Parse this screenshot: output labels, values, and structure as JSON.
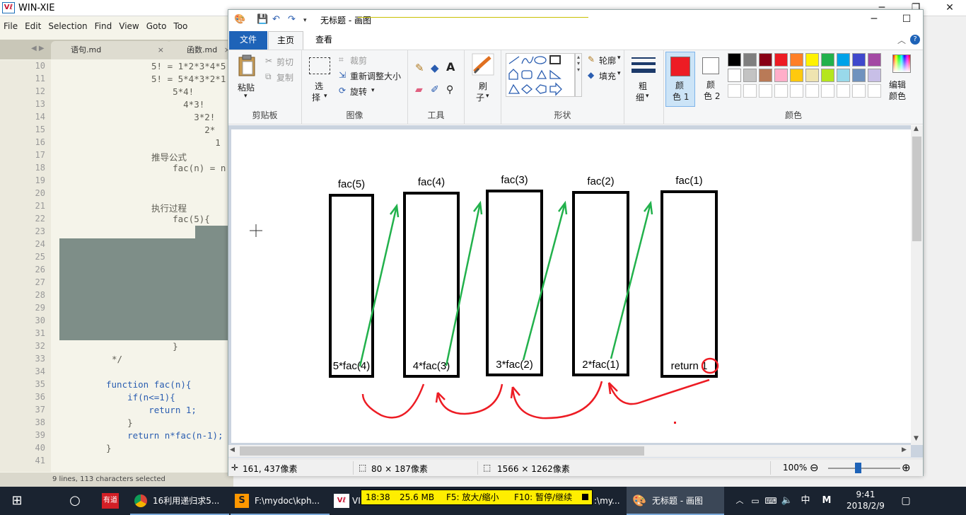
{
  "outer_window": {
    "logo": "Vℓ",
    "title": "WIN-XIE",
    "minimize": "─",
    "restore": "❐",
    "close": "✕"
  },
  "editor": {
    "menu": [
      "File",
      "Edit",
      "Selection",
      "Find",
      "View",
      "Goto",
      "Too"
    ],
    "tabs": [
      {
        "label": "语句.md",
        "close": "×"
      },
      {
        "label": "函数.md",
        "close": "×"
      }
    ],
    "nav": "◀ ▶",
    "lines": [
      {
        "n": "10",
        "code": "5! = 1*2*3*4*5"
      },
      {
        "n": "11",
        "code": "5! = 5*4*3*2*1"
      },
      {
        "n": "12",
        "code": "    5*4!"
      },
      {
        "n": "13",
        "code": "      4*3!"
      },
      {
        "n": "14",
        "code": "        3*2!"
      },
      {
        "n": "15",
        "code": "          2*"
      },
      {
        "n": "16",
        "code": "            1"
      },
      {
        "n": "17",
        "code": "推导公式"
      },
      {
        "n": "18",
        "code": "    fac(n) = n"
      },
      {
        "n": "19",
        "code": ""
      },
      {
        "n": "20",
        "code": ""
      },
      {
        "n": "21",
        "code": "执行过程"
      },
      {
        "n": "22",
        "code": "    fac(5){"
      },
      {
        "n": "23",
        "code": ""
      },
      {
        "n": "24",
        "code": ""
      },
      {
        "n": "25",
        "code": ""
      },
      {
        "n": "26",
        "code": ""
      },
      {
        "n": "27",
        "code": ""
      },
      {
        "n": "28",
        "code": ""
      },
      {
        "n": "29",
        "code": ""
      },
      {
        "n": "30",
        "code": ""
      },
      {
        "n": "31",
        "code": ""
      },
      {
        "n": "32",
        "code": "    }"
      },
      {
        "n": "33",
        "code": "*/"
      },
      {
        "n": "34",
        "code": ""
      },
      {
        "n": "35",
        "code": "function fac(n){"
      },
      {
        "n": "36",
        "code": "    if(n<=1){"
      },
      {
        "n": "37",
        "code": "        return 1;"
      },
      {
        "n": "38",
        "code": "    }"
      },
      {
        "n": "39",
        "code": "    return n*fac(n-1);"
      },
      {
        "n": "40",
        "code": "}"
      },
      {
        "n": "41",
        "code": ""
      }
    ],
    "status": "9 lines, 113 characters selected"
  },
  "paint": {
    "title": "无标题 - 画图",
    "tabs": {
      "file": "文件",
      "home": "主页",
      "view": "查看"
    },
    "clipboard": {
      "paste": "粘贴",
      "cut": "剪切",
      "copy": "复制",
      "label": "剪贴板"
    },
    "image": {
      "select": "选",
      "select2": "择",
      "crop": "裁剪",
      "resize": "重新调整大小",
      "rotate": "旋转",
      "label": "图像"
    },
    "tools": {
      "label": "工具"
    },
    "brushes": {
      "l1": "刷",
      "l2": "子"
    },
    "shapes": {
      "outline": "轮廓",
      "fill": "填充",
      "label": "形状"
    },
    "size": {
      "l1": "粗",
      "l2": "细"
    },
    "color1": {
      "l1": "颜",
      "l2": "色 1",
      "value": "#ed1c24"
    },
    "color2": {
      "l1": "颜",
      "l2": "色 2",
      "value": "#ffffff"
    },
    "edit_colors": {
      "l1": "编辑",
      "l2": "颜色"
    },
    "colors_label": "颜色",
    "palette_row1": [
      "#000000",
      "#7f7f7f",
      "#880015",
      "#ed1c24",
      "#ff7f27",
      "#fff200",
      "#22b14c",
      "#00a2e8",
      "#3f48cc",
      "#a349a4"
    ],
    "palette_row2": [
      "#ffffff",
      "#c3c3c3",
      "#b97a57",
      "#ffaec9",
      "#ffc90e",
      "#efe4b0",
      "#b5e61d",
      "#99d9ea",
      "#7092be",
      "#c8bfe7"
    ],
    "drawing": {
      "frames": [
        {
          "top": "fac(5)",
          "bottom": "5*fac(4)"
        },
        {
          "top": "fac(4)",
          "bottom": "4*fac(3)"
        },
        {
          "top": "fac(3)",
          "bottom": "3*fac(2)"
        },
        {
          "top": "fac(2)",
          "bottom": "2*fac(1)"
        },
        {
          "top": "fac(1)",
          "bottom": "return 1"
        }
      ],
      "arrow_color": "#22b14c",
      "return_color": "#ed1c24"
    },
    "status": {
      "cursor_pos": "161, 437像素",
      "selection_size": "80 × 187像素",
      "image_size": "1566 × 1262像素",
      "zoom": "100%",
      "zoom_out": "⊖",
      "zoom_in": "⊕"
    },
    "window": {
      "minimize": "─",
      "maximize": "☐",
      "close": "✕"
    }
  },
  "recorder": {
    "time": "18:38",
    "size": "25.6 MB",
    "f5": "F5: 放大/缩小",
    "f10": "F10: 暂停/继续"
  },
  "taskbar": {
    "items": [
      {
        "label": "16利用递归求5..."
      },
      {
        "label": "F:\\mydoc\\kph..."
      },
      {
        "label": "VI"
      },
      {
        "label": ":\\my..."
      },
      {
        "label": "无标题 - 画图"
      }
    ],
    "tray": {
      "ime": "中",
      "ime2": "M",
      "time": "9:41",
      "date": "2018/2/9"
    },
    "youdao": "有道"
  }
}
